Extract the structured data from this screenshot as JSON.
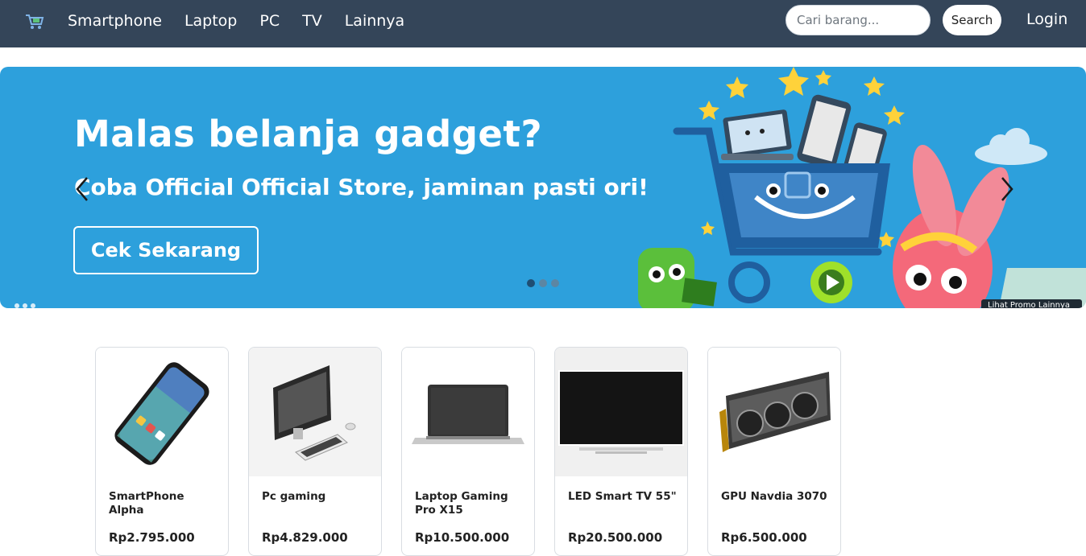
{
  "navbar": {
    "logo_icon": "shopping-cart-logo",
    "links": [
      "Smartphone",
      "Laptop",
      "PC",
      "TV",
      "Lainnya"
    ],
    "search_placeholder": "Cari barang...",
    "search_button": "Search",
    "login": "Login"
  },
  "banner": {
    "title": "Malas belanja gadget?",
    "subtitle": "Coba Official Official Store, jaminan pasti ori!",
    "cta": "Cek Sekarang",
    "promo_link": "Lihat Promo Lainnya",
    "background_color": "#2da0dc",
    "slide_count": 3,
    "active_slide": 1
  },
  "products": [
    {
      "name": "SmartPhone Alpha",
      "price": "Rp2.795.000",
      "image": "smartphone"
    },
    {
      "name": "Pc gaming",
      "price": "Rp4.829.000",
      "image": "desktop-pc"
    },
    {
      "name": "Laptop Gaming Pro X15",
      "price": "Rp10.500.000",
      "image": "laptop"
    },
    {
      "name": "LED Smart TV 55\"",
      "price": "Rp20.500.000",
      "image": "tv"
    },
    {
      "name": "GPU Navdia 3070",
      "price": "Rp6.500.000",
      "image": "gpu"
    }
  ],
  "colors": {
    "navbar": "#344559",
    "accent": "#2da0dc"
  }
}
